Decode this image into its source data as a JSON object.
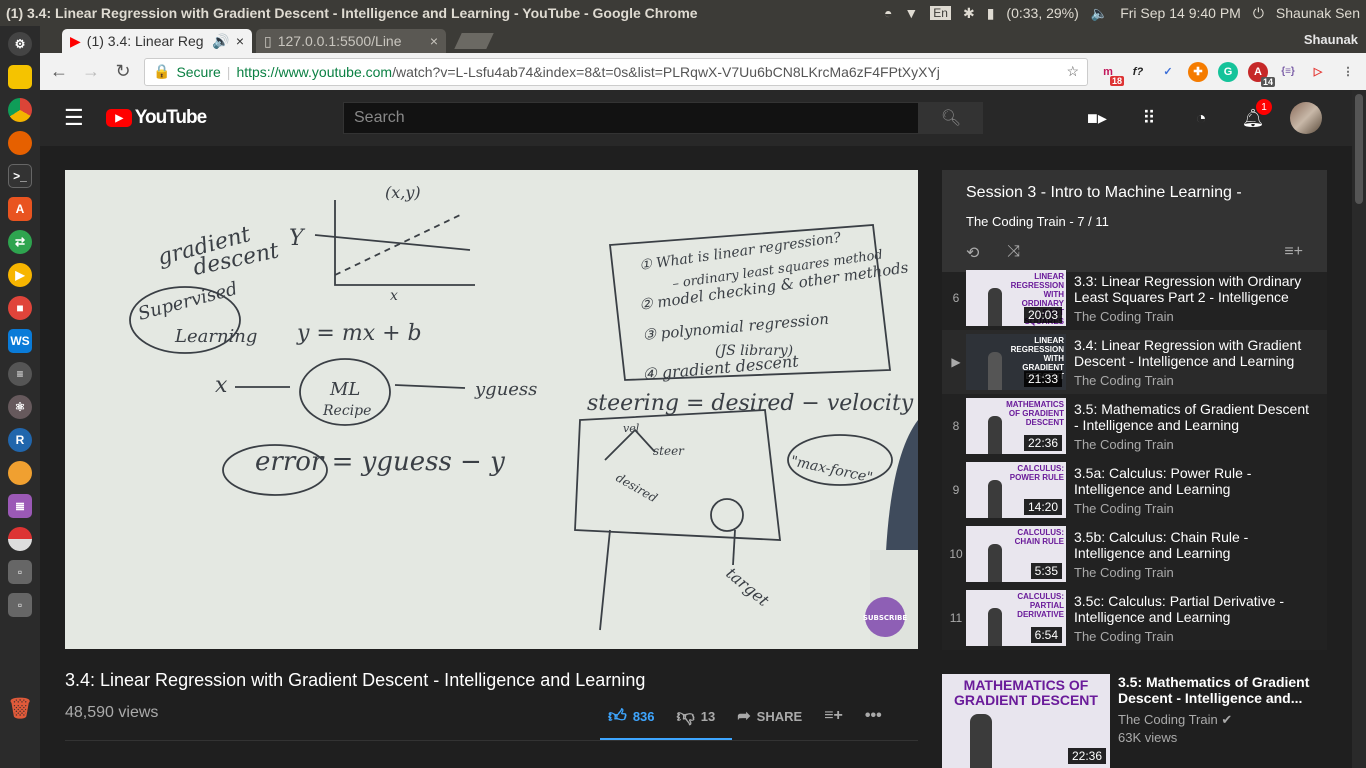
{
  "window_title": "(1) 3.4: Linear Regression with Gradient Descent - Intelligence and Learning - YouTube - Google Chrome",
  "system": {
    "battery": "(0:33, 29%)",
    "datetime": "Fri Sep 14  9:40 PM",
    "user": "Shaunak Sen",
    "keyboard": "En"
  },
  "tabs": [
    {
      "label": "(1) 3.4: Linear Reg",
      "active": true
    },
    {
      "label": "127.0.0.1:5500/Line",
      "active": false
    }
  ],
  "profile_name": "Shaunak",
  "omnibox": {
    "secure_label": "Secure",
    "url_host": "https://www.youtube.com",
    "url_path": "/watch?v=L-Lsfu4ab74&index=8&t=0s&list=PLRqwX-V7Uu6bCN8LKrcMa6zF4FPtXyXYj"
  },
  "extensions": {
    "mail_count": "18",
    "adblock_count": "14"
  },
  "youtube": {
    "logo_text": "YouTube",
    "search_placeholder": "Search",
    "notification_count": "1"
  },
  "video": {
    "title": "3.4: Linear Regression with Gradient Descent - Intelligence and Learning",
    "views": "48,590 views",
    "likes": "836",
    "dislikes": "13",
    "share_label": "SHARE",
    "subscribe_label": "SUBSCRIBE"
  },
  "playlist": {
    "title": "Session 3 - Intro to Machine Learning -",
    "subtitle": "The Coding Train - 7 / 11",
    "items": [
      {
        "index": "6",
        "title": "3.3: Linear Regression with Ordinary Least Squares Part 2 - Intelligence",
        "channel": "The Coding Train",
        "duration": "20:03",
        "thumb_text": "LINEAR REGRESSION WITH ORDINARY LEAST SQUARES PART 2"
      },
      {
        "index": "▶",
        "title": "3.4: Linear Regression with Gradient Descent - Intelligence and Learning",
        "channel": "The Coding Train",
        "duration": "21:33",
        "thumb_text": "LINEAR REGRESSION WITH GRADIENT DESCENT"
      },
      {
        "index": "8",
        "title": "3.5: Mathematics of Gradient Descent - Intelligence and Learning",
        "channel": "The Coding Train",
        "duration": "22:36",
        "thumb_text": "MATHEMATICS OF GRADIENT DESCENT"
      },
      {
        "index": "9",
        "title": "3.5a: Calculus: Power Rule - Intelligence and Learning",
        "channel": "The Coding Train",
        "duration": "14:20",
        "thumb_text": "CALCULUS: POWER RULE"
      },
      {
        "index": "10",
        "title": "3.5b: Calculus: Chain Rule - Intelligence and Learning",
        "channel": "The Coding Train",
        "duration": "5:35",
        "thumb_text": "CALCULUS: CHAIN RULE"
      },
      {
        "index": "11",
        "title": "3.5c: Calculus: Partial Derivative - Intelligence and Learning",
        "channel": "The Coding Train",
        "duration": "6:54",
        "thumb_text": "CALCULUS: PARTIAL DERIVATIVE"
      }
    ]
  },
  "up_next": {
    "title": "3.5: Mathematics of Gradient Descent - Intelligence and...",
    "channel": "The Coding Train",
    "views": "63K views",
    "duration": "22:36",
    "thumb_text": "MATHEMATICS OF GRADIENT DESCENT"
  },
  "whiteboard": {
    "gradient": "gradient",
    "descent": "descent",
    "supervised": "Supervised",
    "learning": "Learning",
    "y_label": "Y",
    "x_label": "x",
    "xy_label": "(x,y)",
    "equation": "y = mx + b",
    "x_input": "x",
    "ml": "ML",
    "recipe": "Recipe",
    "yguess": "yguess",
    "error_eq": "error = yguess − y",
    "list1": "① What is linear regression?",
    "list1b": "– ordinary least squares method",
    "list2": "② model checking & other methods",
    "list3": "③ polynomial regression",
    "list3b": "(JS library)",
    "list4": "④ gradient descent",
    "steering": "steering = desired − velocity",
    "vel": "vel",
    "steer": "steer",
    "desired": "desired",
    "maxforce": "\"max-force\"",
    "target": "target"
  }
}
